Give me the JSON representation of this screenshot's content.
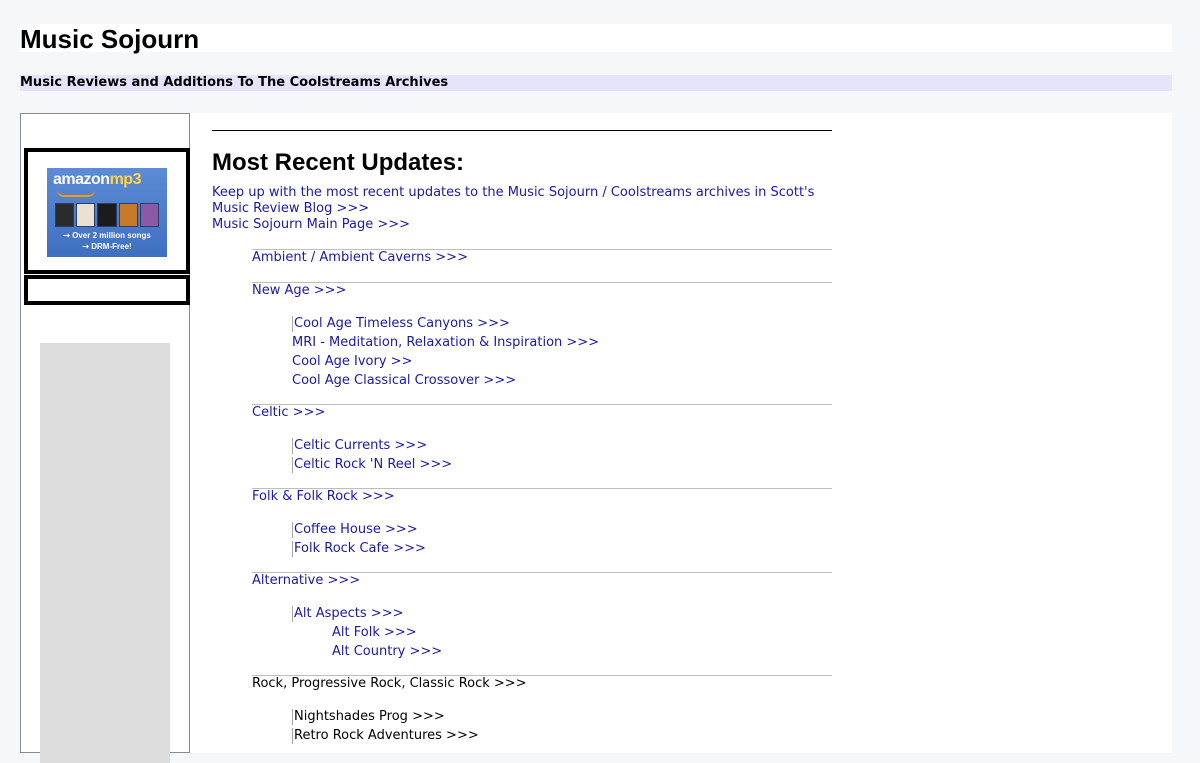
{
  "site": {
    "title": "Music Sojourn",
    "subtitle": "Music Reviews and Additions To The Coolstreams Archives"
  },
  "ad": {
    "logo_amazon": "amazon",
    "logo_mp3": "mp3",
    "tagline_1": "Over 2 million songs",
    "tagline_2": "DRM-Free!",
    "album_colors": [
      "#2b2b2b",
      "#e9e2d2",
      "#1b1b1b",
      "#c87a2a",
      "#8a5aa8"
    ]
  },
  "main": {
    "heading": "Most Recent Updates:",
    "intro_link": "Keep up with the most recent updates to the Music Sojourn / Coolstreams archives in Scott's Music Review Blog >>>",
    "main_page_link": "Music Sojourn Main Page >>>",
    "categories": [
      {
        "label": "Ambient / Ambient Caverns >>>",
        "subs": []
      },
      {
        "label": "New Age >>>",
        "subs": [
          "Cool Age Timeless Canyons >>>",
          "MRI - Meditation, Relaxation & Inspiration >>>",
          "Cool Age Ivory >>",
          "Cool Age Classical Crossover >>>"
        ]
      },
      {
        "label": "Celtic >>>",
        "subs": [
          "Celtic Currents >>>",
          "Celtic Rock 'N Reel >>>"
        ]
      },
      {
        "label": "Folk & Folk Rock >>>",
        "subs": [
          "Coffee House >>>",
          "Folk Rock Cafe >>>"
        ]
      },
      {
        "label": "Alternative >>>",
        "subs": [
          "Alt Aspects >>>"
        ],
        "subsubs": [
          "Alt Folk >>>",
          "Alt Country >>>"
        ]
      },
      {
        "label": "Rock, Progressive Rock, Classic Rock >>>",
        "subs": [
          "Nightshades Prog >>>",
          "Retro Rock Adventures >>>"
        ]
      }
    ]
  },
  "colors": {
    "link": "#1a1aa6",
    "page_bg": "#f6f7f9",
    "subtitle_bar": "#e6e4fb",
    "sidebar_ad_gray": "#dcdcdc"
  }
}
